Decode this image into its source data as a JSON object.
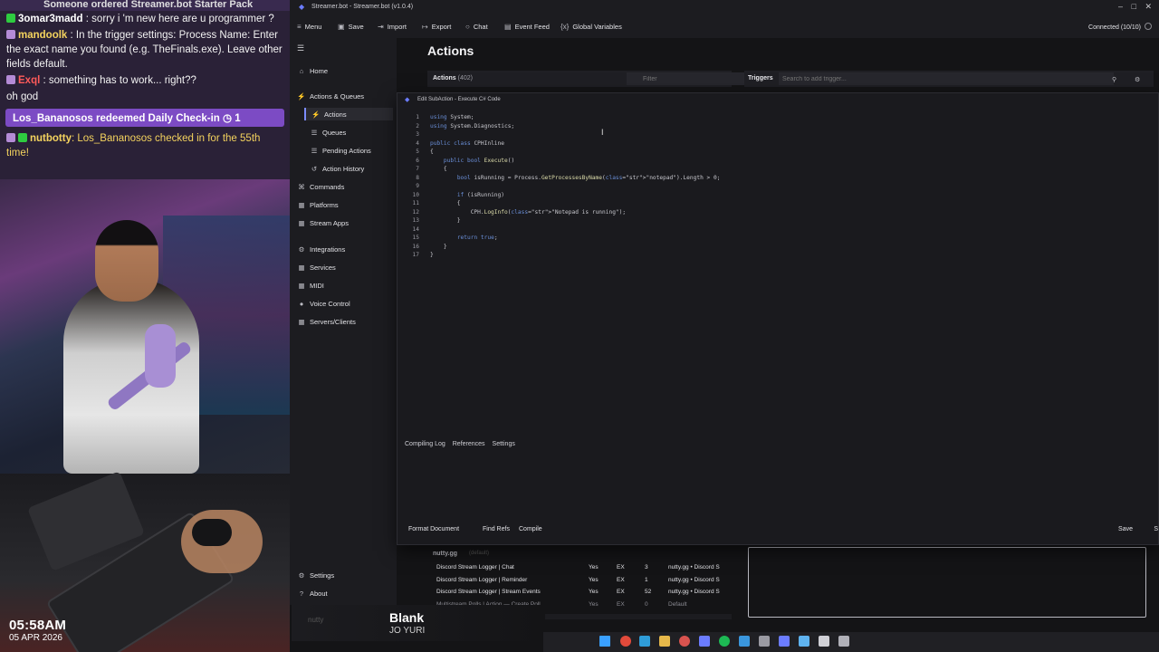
{
  "stream": {
    "chat_top_partial": "Someone ordered Streamer.bot Starter Pack",
    "chat": [
      {
        "user": "3omar3madd",
        "text": ": sorry i 'm new here are u programmer ?",
        "user_color": "#ffffff",
        "badge_color": "#2ecc40"
      },
      {
        "user": "mandoolk",
        "text": ": In the trigger settings: Process Name: Enter the exact name you found (e.g. TheFinals.exe). Leave other fields default.",
        "user_color": "#f4d35e",
        "badge_color": "#b48bd6"
      },
      {
        "user": "Exql",
        "text": ": something has to work... right??",
        "user_color": "#ff5a5a",
        "badge_color": "#b48bd6"
      },
      {
        "user": "",
        "text": "oh god",
        "user_color": "#ffffff",
        "badge_color": ""
      }
    ],
    "redeem": "Los_Bananosos redeemed Daily Check-in ◷ 1",
    "bot_line": {
      "user": "nutbotty",
      "text": ": Los_Bananosos checked in for the 55th time!",
      "user_color": "#f4d35e",
      "text_color": "#f4d35e"
    },
    "clock": "05:58AM",
    "clock_date": "05 APR 2026",
    "now_playing_title": "Blank",
    "now_playing_artist": "JO YURI",
    "now_playing_user": "nutty"
  },
  "app": {
    "title": "Streamer.bot - Streamer.bot (v1.0.4)",
    "menu": [
      {
        "icon": "≡",
        "label": "Menu"
      },
      {
        "icon": "▣",
        "label": "Save"
      },
      {
        "icon": "⇥",
        "label": "Import"
      },
      {
        "icon": "↦",
        "label": "Export"
      },
      {
        "icon": "○",
        "label": "Chat"
      },
      {
        "icon": "▤",
        "label": "Event Feed"
      },
      {
        "icon": "{x}",
        "label": "Global Variables"
      }
    ],
    "connection": "Connected (10/10)"
  },
  "sidebar": {
    "items": [
      {
        "icon": "⌂",
        "label": "Home"
      },
      {
        "icon": "⚡",
        "label": "Actions & Queues"
      },
      {
        "icon": "⚡",
        "label": "Actions"
      },
      {
        "icon": "☰",
        "label": "Queues"
      },
      {
        "icon": "☰",
        "label": "Pending Actions"
      },
      {
        "icon": "↺",
        "label": "Action History"
      },
      {
        "icon": "⌘",
        "label": "Commands"
      },
      {
        "icon": "▦",
        "label": "Platforms"
      },
      {
        "icon": "▦",
        "label": "Stream Apps"
      },
      {
        "icon": "⚙",
        "label": "Integrations"
      },
      {
        "icon": "▦",
        "label": "Services"
      },
      {
        "icon": "▦",
        "label": "MIDI"
      },
      {
        "icon": "●",
        "label": "Voice Control"
      },
      {
        "icon": "▦",
        "label": "Servers/Clients"
      },
      {
        "icon": "⚙",
        "label": "Settings"
      },
      {
        "icon": "?",
        "label": "About"
      }
    ]
  },
  "main": {
    "title": "Actions",
    "actions_label": "Actions",
    "actions_count": "(402)",
    "filter_placeholder": "Filter",
    "triggers_label": "Triggers",
    "trigger_search_placeholder": "Search to add trigger..."
  },
  "editor": {
    "title": "Edit SubAction - Execute C# Code",
    "code_lines": [
      "using System;",
      "using System.Diagnostics;",
      "",
      "public class CPHInline",
      "{",
      "    public bool Execute()",
      "    {",
      "        bool isRunning = Process.GetProcessesByName(\"notepad\").Length > 0;",
      "",
      "        if (isRunning)",
      "        {",
      "            CPH.LogInfo(\"Notepad is running\");",
      "        }",
      "",
      "        return true;",
      "    }",
      "}"
    ],
    "tabs": [
      "Compiling Log",
      "References",
      "Settings"
    ],
    "buttons": {
      "format": "Format Document",
      "find_refs": "Find Refs",
      "compile": "Compile",
      "save": "Save",
      "s": "S"
    }
  },
  "actions_list": {
    "group": "nutty.gg",
    "group_sub": "(default)",
    "rows": [
      {
        "name": "Discord Stream Logger | Chat",
        "enabled": "Yes",
        "ex": "EX",
        "count": "3",
        "group": "nutty.gg • Discord S"
      },
      {
        "name": "Discord Stream Logger | Reminder",
        "enabled": "Yes",
        "ex": "EX",
        "count": "1",
        "group": "nutty.gg • Discord S"
      },
      {
        "name": "Discord Stream Logger | Stream Events",
        "enabled": "Yes",
        "ex": "EX",
        "count": "52",
        "group": "nutty.gg • Discord S"
      },
      {
        "name": "Multistream Polls | Action — Create Poll",
        "enabled": "Yes",
        "ex": "EX",
        "count": "0",
        "group": "Default"
      }
    ]
  },
  "taskbar": {
    "icons": [
      {
        "name": "windows-start-icon",
        "color": "#3aa0ff"
      },
      {
        "name": "chrome-icon",
        "color": "#e24a3b"
      },
      {
        "name": "edge-icon",
        "color": "#2f9cd8"
      },
      {
        "name": "folder-icon",
        "color": "#e6b84a"
      },
      {
        "name": "obs-icon",
        "color": "#d9534f"
      },
      {
        "name": "discord-icon",
        "color": "#6b7cff"
      },
      {
        "name": "spotify-icon",
        "color": "#1db954"
      },
      {
        "name": "vscode-icon",
        "color": "#3a96dd"
      },
      {
        "name": "terminal-icon",
        "color": "#9a9aa2"
      },
      {
        "name": "streamerbot-icon",
        "color": "#6b7cff"
      },
      {
        "name": "notepad-icon",
        "color": "#5fb3f0"
      },
      {
        "name": "app-icon",
        "color": "#d0d0d6"
      },
      {
        "name": "monitor-icon",
        "color": "#b0b0b8"
      }
    ]
  }
}
